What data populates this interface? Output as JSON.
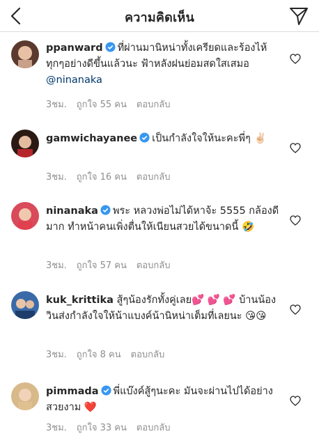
{
  "header": {
    "title": "ความคิดเห็น"
  },
  "comments": [
    {
      "username": "ppanward",
      "text": "ที่ผ่านมานิหน่าทั้งเครียดและร้องไห้ ทุกๆอย่างดีขึ้นแล้วนะ ฟ้าหลังฝนย่อมสดใสเสมอ ",
      "mention": "@ninanaka",
      "time": "3ชม.",
      "likes": "ถูกใจ 55 คน",
      "reply": "ตอบกลับ"
    },
    {
      "username": "gamwichayanee",
      "text": "เป็นกำลังใจให้นะคะพี่ๆ ✌🏻",
      "time": "3ชม.",
      "likes": "ถูกใจ 16 คน",
      "reply": "ตอบกลับ"
    },
    {
      "username": "ninanaka",
      "text": "พระ หลวงพ่อไม่ได้หาจ้ะ 5555 กล้องดีมาก ทำหน้าคนเพิ่งตื่นให้เนียนสวยได้ขนาดนี้ 🤣",
      "time": "3ชม.",
      "likes": "ถูกใจ 57 คน",
      "reply": "ตอบกลับ"
    },
    {
      "username": "kuk_krittika",
      "text": "สู้ๆน้องรักทั้งคู่เลย💕 💕 💕 บ้านน้องวินส่งกำลังใจให้น้าแบงค์น้านิหน่าเต็มที่เลยนะ 😘😘",
      "time": "3ชม.",
      "likes": "ถูกใจ 8 คน",
      "reply": "ตอบกลับ"
    },
    {
      "username": "pimmada",
      "text": "พี่แบ๊งค์สู้ๆนะคะ มันจะผ่านไปได้อย่างสวยงาม ❤️",
      "time": "3ชม.",
      "likes": "ถูกใจ 33 คน",
      "reply": "ตอบกลับ"
    }
  ]
}
